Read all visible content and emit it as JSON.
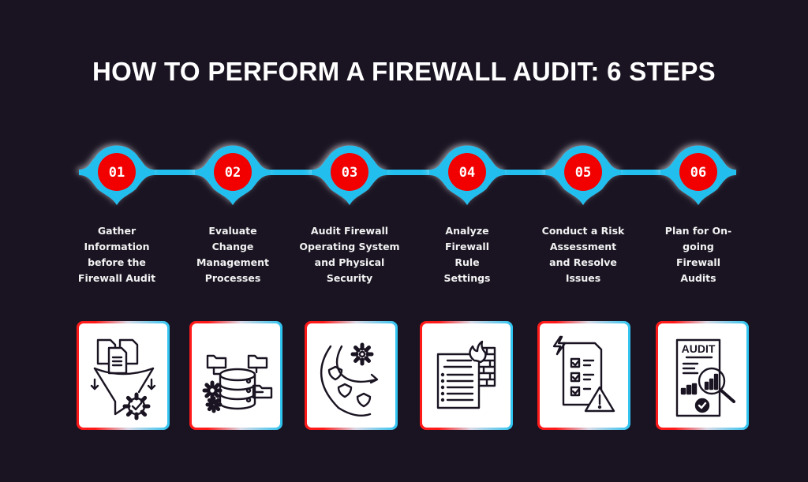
{
  "title": "HOW TO PERFORM A FIREWALL AUDIT: 6 STEPS",
  "colors": {
    "background": "#1a1422",
    "timeline": "#22bfee",
    "marker": "#f20505",
    "card_border_left": "#ff1a1a",
    "card_border_right": "#2ec3f0",
    "icon_stroke": "#1a1422"
  },
  "steps": [
    {
      "number": "01",
      "label_lines": [
        "Gather",
        "Information",
        "before the",
        "Firewall Audit"
      ],
      "icon": "funnel-documents-gear-check-icon"
    },
    {
      "number": "02",
      "label_lines": [
        "Evaluate",
        "Change",
        "Management",
        "Processes"
      ],
      "icon": "database-folders-gears-icon"
    },
    {
      "number": "03",
      "label_lines": [
        "Audit Firewall",
        "Operating System",
        "and Physical",
        "Security"
      ],
      "icon": "shields-gear-cycle-icon"
    },
    {
      "number": "04",
      "label_lines": [
        "Analyze",
        "Firewall",
        "Rule",
        "Settings"
      ],
      "icon": "firewall-document-icon"
    },
    {
      "number": "05",
      "label_lines": [
        "Conduct a Risk",
        "Assessment",
        "and Resolve",
        "Issues"
      ],
      "icon": "checklist-warning-icon"
    },
    {
      "number": "06",
      "label_lines": [
        "Plan for On-",
        "going",
        "Firewall",
        "Audits"
      ],
      "icon": "audit-report-magnifier-icon"
    }
  ],
  "audit_icon_text": "AUDIT"
}
